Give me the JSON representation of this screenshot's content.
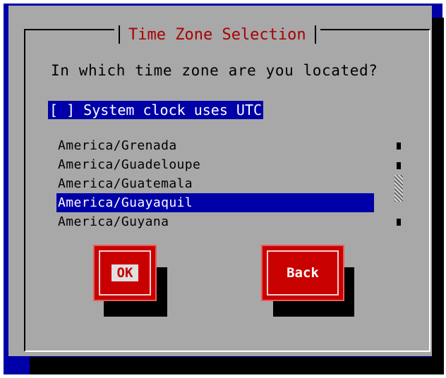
{
  "dialog": {
    "title": "Time Zone Selection",
    "question": "In which time zone are you located?"
  },
  "utc_option": {
    "checkbox": "[ ]",
    "label": "System clock uses UTC",
    "checked": false
  },
  "timezone_list": {
    "items": [
      "America/Grenada",
      "America/Guadeloupe",
      "America/Guatemala",
      "America/Guayaquil",
      "America/Guyana"
    ],
    "selected": "America/Guayaquil"
  },
  "buttons": {
    "ok_label": "OK",
    "back_label": "Back"
  },
  "colors": {
    "background": "#0000a8",
    "dialog": "#a8a8a8",
    "title": "#a80000",
    "highlight": "#0000a8",
    "button": "#c80000"
  }
}
